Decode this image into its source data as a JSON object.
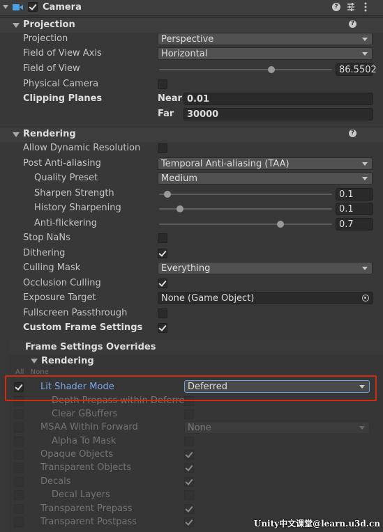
{
  "component": {
    "title": "Camera",
    "enabled": true,
    "icons": [
      "help-icon",
      "preset-icon",
      "more-icon"
    ]
  },
  "projection_section": {
    "title": "Projection",
    "projection": {
      "label": "Projection",
      "value": "Perspective"
    },
    "fov_axis": {
      "label": "Field of View Axis",
      "value": "Horizontal"
    },
    "fov": {
      "label": "Field of View",
      "value": "86.5502",
      "slider_fraction": 0.65
    },
    "physical_camera": {
      "label": "Physical Camera",
      "checked": false
    },
    "clipping": {
      "label": "Clipping Planes",
      "near_label": "Near",
      "near_value": "0.01",
      "far_label": "Far",
      "far_value": "30000"
    }
  },
  "rendering_section": {
    "title": "Rendering",
    "allow_dynamic_resolution": {
      "label": "Allow Dynamic Resolution",
      "checked": false
    },
    "post_anti_aliasing": {
      "label": "Post Anti-aliasing",
      "value": "Temporal Anti-aliasing (TAA)"
    },
    "quality_preset": {
      "label": "Quality Preset",
      "value": "Medium"
    },
    "sharpen_strength": {
      "label": "Sharpen Strength",
      "value": "0.1",
      "slider_fraction": 0.05
    },
    "history_sharpening": {
      "label": "History Sharpening",
      "value": "0.1",
      "slider_fraction": 0.12
    },
    "anti_flickering": {
      "label": "Anti-flickering",
      "value": "0.7",
      "slider_fraction": 0.7
    },
    "stop_nans": {
      "label": "Stop NaNs",
      "checked": false
    },
    "dithering": {
      "label": "Dithering",
      "checked": true
    },
    "culling_mask": {
      "label": "Culling Mask",
      "value": "Everything"
    },
    "occlusion_culling": {
      "label": "Occlusion Culling",
      "checked": true
    },
    "exposure_target": {
      "label": "Exposure Target",
      "value": "None (Game Object)"
    },
    "fullscreen_passthrough": {
      "label": "Fullscreen Passthrough",
      "checked": false
    },
    "custom_frame_settings": {
      "label": "Custom Frame Settings",
      "checked": true
    }
  },
  "frame_settings": {
    "title": "Frame Settings Overrides",
    "subsection": "Rendering",
    "all_label": "All",
    "none_label": "None",
    "rows": [
      {
        "label": "Lit Shader Mode",
        "override": true,
        "kind": "dropdown",
        "value": "Deferred",
        "active": true,
        "indent": 0
      },
      {
        "label": "Depth Prepass within Deferred",
        "override": false,
        "kind": "check",
        "checked": false,
        "active": false,
        "indent": 1
      },
      {
        "label": "Clear GBuffers",
        "override": false,
        "kind": "check",
        "checked": false,
        "active": false,
        "indent": 1
      },
      {
        "label": "MSAA Within Forward",
        "override": false,
        "kind": "dropdown",
        "value": "None",
        "active": false,
        "indent": 0
      },
      {
        "label": "Alpha To Mask",
        "override": false,
        "kind": "check",
        "checked": false,
        "active": false,
        "indent": 1
      },
      {
        "label": "Opaque Objects",
        "override": false,
        "kind": "check",
        "checked": true,
        "active": false,
        "indent": 0
      },
      {
        "label": "Transparent Objects",
        "override": false,
        "kind": "check",
        "checked": true,
        "active": false,
        "indent": 0
      },
      {
        "label": "Decals",
        "override": false,
        "kind": "check",
        "checked": true,
        "active": false,
        "indent": 0
      },
      {
        "label": "Decal Layers",
        "override": false,
        "kind": "check",
        "checked": false,
        "active": false,
        "indent": 1
      },
      {
        "label": "Transparent Prepass",
        "override": false,
        "kind": "check",
        "checked": true,
        "active": false,
        "indent": 0
      },
      {
        "label": "Transparent Postpass",
        "override": false,
        "kind": "check",
        "checked": true,
        "active": false,
        "indent": 0
      }
    ]
  },
  "watermark": "Unity中文课堂@learn.u3d.cn",
  "colors": {
    "highlight": "#d42a10",
    "accent": "#7ba6e8",
    "background": "#383838"
  }
}
